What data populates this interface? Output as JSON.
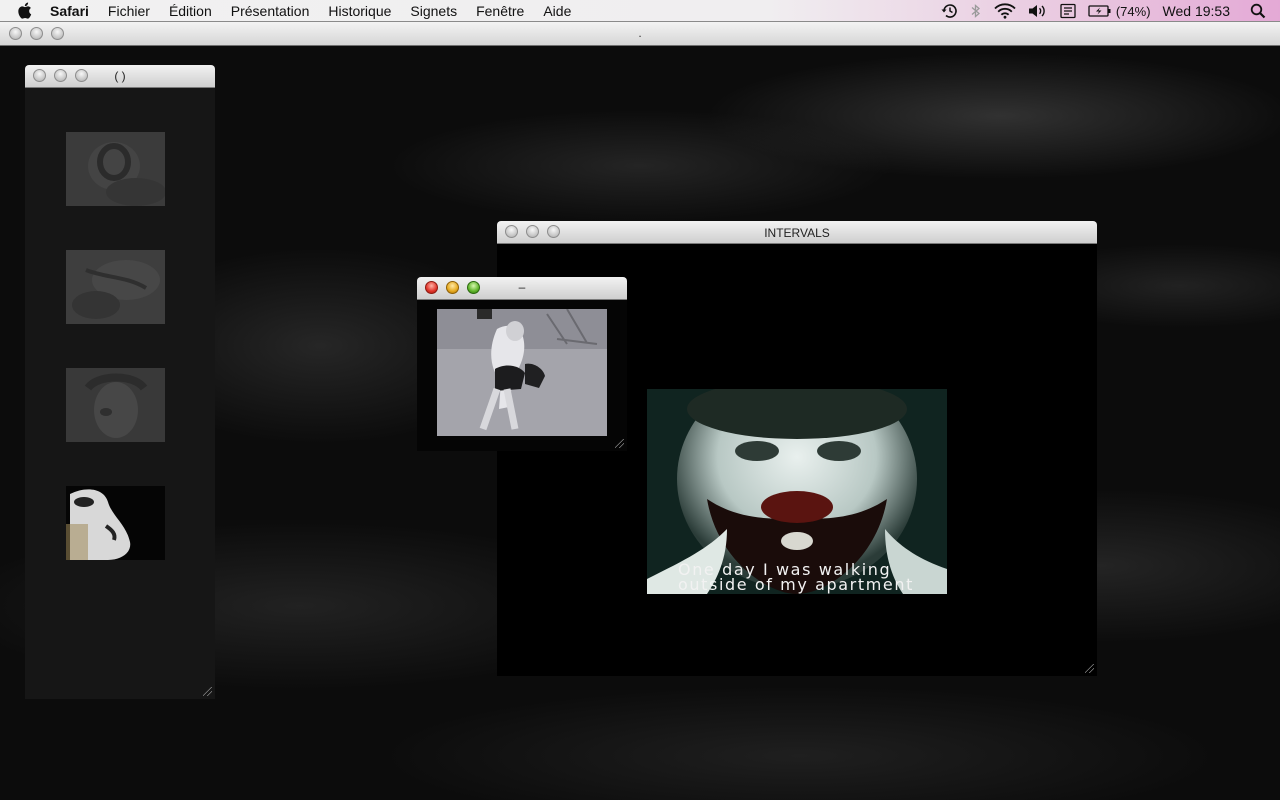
{
  "menubar": {
    "app_name": "Safari",
    "items": [
      "Fichier",
      "Édition",
      "Présentation",
      "Historique",
      "Signets",
      "Fenêtre",
      "Aide"
    ],
    "status": {
      "battery": "(74%)",
      "clock": "Wed 19:53"
    }
  },
  "browser": {
    "page_title": "."
  },
  "windows": {
    "thumbs": {
      "title": "( )"
    },
    "small": {
      "title": "–"
    },
    "intervals": {
      "title": "INTERVALS"
    }
  },
  "video": {
    "subtitle_line1": "One day I was walking",
    "subtitle_line2": "outside of my apartment"
  },
  "icons": {
    "apple": "apple-icon",
    "time_machine": "time-machine-icon",
    "bluetooth": "bluetooth-icon",
    "wifi": "wifi-icon",
    "volume": "volume-icon",
    "input": "keyboard-input-icon",
    "battery": "battery-icon",
    "spotlight": "spotlight-search-icon"
  }
}
